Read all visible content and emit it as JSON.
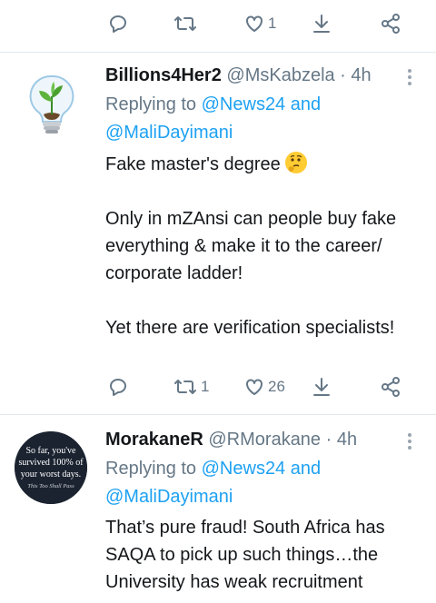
{
  "top_actions": {
    "like_count": "1"
  },
  "tweets": [
    {
      "display_name": "Billions4Her2",
      "handle_time": "@MsKabzela · 4h",
      "replying_prefix": "Replying to",
      "mention_1": "@News24",
      "and_word": "and",
      "mention_2": "@MaliDayimani",
      "text_1": "Fake master's degree",
      "emoji": "thinking-face",
      "text_2": "Only in mZAnsi can people buy fake everything & make it to the career/ corporate ladder!",
      "text_3": "Yet there are verification specialists!",
      "retweet_count": "1",
      "like_count": "26"
    },
    {
      "display_name": "MorakaneR",
      "handle_time": "@RMorakane · 4h",
      "replying_prefix": "Replying to",
      "mention_1": "@News24",
      "and_word": "and",
      "mention_2": "@MaliDayimani",
      "text_1": "That’s pure fraud! South Africa has SAQA to pick up such things…the University has weak recruitment",
      "avatar_text_1": "So far, you've",
      "avatar_text_2": "survived 100% of",
      "avatar_text_3": "your worst days.",
      "avatar_text_4": "This Too Shall Pass"
    }
  ],
  "icons": [
    "reply-icon",
    "retweet-icon",
    "like-icon",
    "bookmark-icon",
    "share-icon",
    "more-icon"
  ],
  "colors": {
    "mention": "#1da1f2",
    "secondary_text": "#657786",
    "divider": "#e1e8ed"
  }
}
